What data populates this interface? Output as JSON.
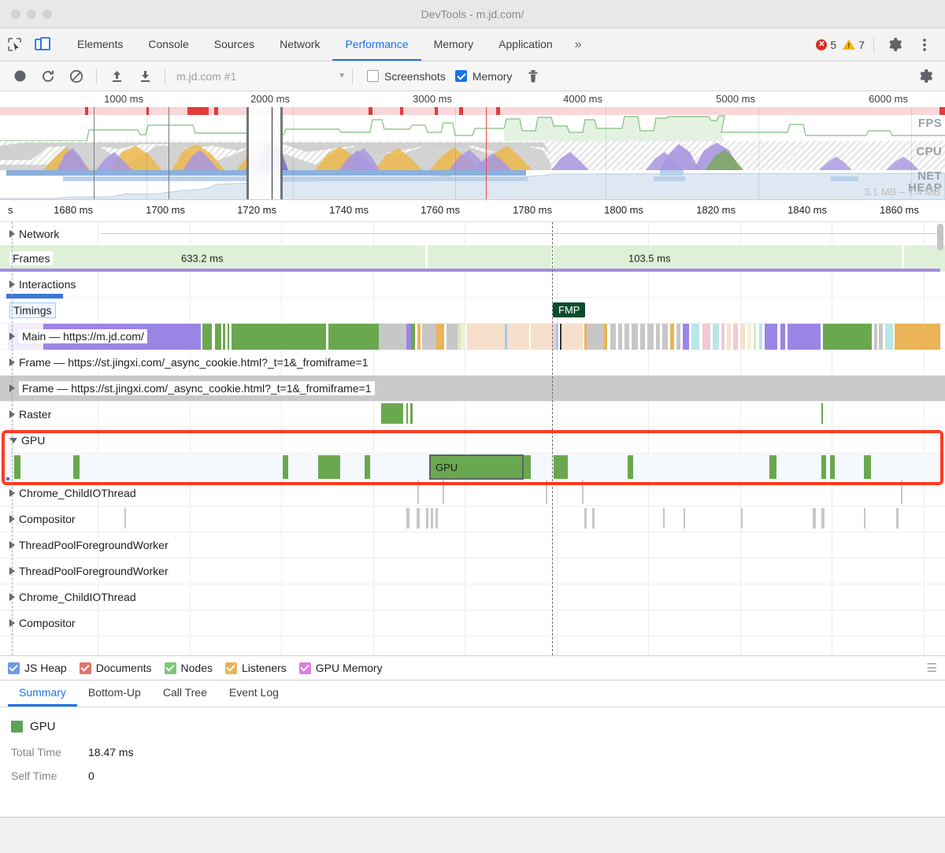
{
  "window": {
    "title": "DevTools - m.jd.com/"
  },
  "tabs": {
    "items": [
      {
        "label": "Elements",
        "active": false
      },
      {
        "label": "Console",
        "active": false
      },
      {
        "label": "Sources",
        "active": false
      },
      {
        "label": "Network",
        "active": false
      },
      {
        "label": "Performance",
        "active": true
      },
      {
        "label": "Memory",
        "active": false
      },
      {
        "label": "Application",
        "active": false
      }
    ],
    "more": "»",
    "errors": "5",
    "warnings": "7"
  },
  "perf_toolbar": {
    "record_icon": "record-icon",
    "reload_icon": "reload-record-icon",
    "clear_icon": "clear-icon",
    "upload_icon": "load-profile-icon",
    "download_icon": "save-profile-icon",
    "profile_value": "m.jd.com #1",
    "screenshots_label": "Screenshots",
    "screenshots_checked": false,
    "memory_label": "Memory",
    "memory_checked": true,
    "trash_icon": "trash-icon",
    "settings_icon": "gear-icon"
  },
  "overview": {
    "ticks": [
      "1000 ms",
      "2000 ms",
      "3000 ms",
      "4000 ms",
      "5000 ms",
      "6000 ms"
    ],
    "lanes": [
      "FPS",
      "CPU",
      "NET",
      "HEAP"
    ],
    "heap_range": "3.1 MB – 7.4 MB"
  },
  "timeline": {
    "ruler_prefix": "s",
    "ticks": [
      "1680 ms",
      "1700 ms",
      "1720 ms",
      "1740 ms",
      "1760 ms",
      "1780 ms",
      "1800 ms",
      "1820 ms",
      "1840 ms",
      "1860 ms"
    ],
    "tracks": [
      {
        "name": "Network",
        "expanded": false
      },
      {
        "name": "Frames",
        "expanded": false
      },
      {
        "name": "Interactions",
        "expanded": false
      },
      {
        "name": "Timings",
        "expanded": false
      },
      {
        "name": "Main — https://m.jd.com/",
        "expanded": false
      },
      {
        "name": "Frame — https://st.jingxi.com/_async_cookie.html?_t=1&_fromiframe=1",
        "expanded": false
      },
      {
        "name": "Frame — https://st.jingxi.com/_async_cookie.html?_t=1&_fromiframe=1",
        "expanded": false
      },
      {
        "name": "Raster",
        "expanded": false
      },
      {
        "name": "GPU",
        "expanded": true
      },
      {
        "name": "Chrome_ChildIOThread",
        "expanded": false
      },
      {
        "name": "Compositor",
        "expanded": false
      },
      {
        "name": "ThreadPoolForegroundWorker",
        "expanded": false
      },
      {
        "name": "ThreadPoolForegroundWorker",
        "expanded": false
      },
      {
        "name": "Chrome_ChildIOThread",
        "expanded": false
      },
      {
        "name": "Compositor",
        "expanded": false
      }
    ],
    "frames": [
      {
        "label": "633.2 ms"
      },
      {
        "label": "103.5 ms"
      }
    ],
    "markers": [
      {
        "label": "FMP"
      }
    ],
    "selected_event_label": "GPU",
    "highlight_color": "#fc3b24"
  },
  "counters": {
    "items": [
      {
        "label": "JS Heap",
        "color": "#6e9ae8",
        "checked": true
      },
      {
        "label": "Documents",
        "color": "#e4726e",
        "checked": true
      },
      {
        "label": "Nodes",
        "color": "#78c97a",
        "checked": true
      },
      {
        "label": "Listeners",
        "color": "#eab457",
        "checked": true
      },
      {
        "label": "GPU Memory",
        "color": "#e07ce0",
        "checked": true
      }
    ],
    "menu_icon": "hamburger-icon"
  },
  "detail_tabs": {
    "items": [
      {
        "label": "Summary",
        "active": true
      },
      {
        "label": "Bottom-Up",
        "active": false
      },
      {
        "label": "Call Tree",
        "active": false
      },
      {
        "label": "Event Log",
        "active": false
      }
    ]
  },
  "summary": {
    "event_name": "GPU",
    "swatch_color": "#5aa454",
    "rows": [
      {
        "key": "Total Time",
        "value": "18.47 ms"
      },
      {
        "key": "Self Time",
        "value": "0"
      }
    ]
  }
}
